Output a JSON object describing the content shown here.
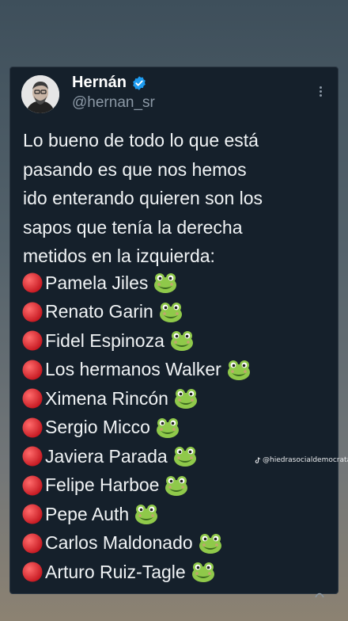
{
  "user": {
    "name": "Hernán",
    "handle": "@hernan_sr"
  },
  "tweet": {
    "lines": [
      "Lo bueno de todo lo que está",
      "pasando es que nos hemos",
      "ido enterando quieren son los",
      "sapos que tenía la derecha",
      "metidos en la izquierda:"
    ],
    "list": [
      "Pamela Jiles",
      "Renato Garin",
      "Fidel Espinoza",
      "Los hermanos Walker",
      "Ximena Rincón",
      "Sergio Micco ",
      "Javiera Parada ",
      "Felipe Harboe",
      "Pepe Auth",
      "Carlos Maldonado",
      "Arturo Ruiz-Tagle"
    ]
  },
  "watermark": "@hiedrasocialdemocrata",
  "colors": {
    "card_bg": "#15202b",
    "text": "#f0f3f5",
    "muted": "#8b98a5",
    "verified": "#1d9bf0",
    "red_dot": "#e0242e",
    "frog": "#8fc94a"
  }
}
